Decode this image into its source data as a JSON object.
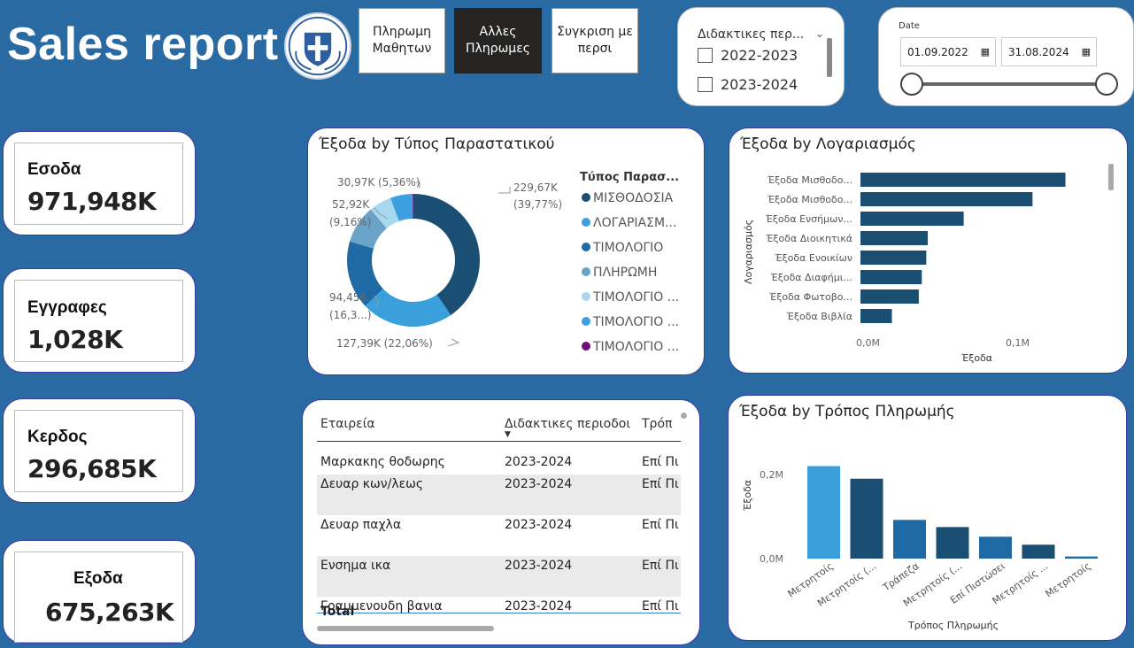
{
  "header": {
    "title": "Sales report",
    "nav_buttons": [
      "Πληρωμη\nΜαθητων",
      "Αλλες\nΠληρωμες",
      "Συγκριση με\nπερσι"
    ]
  },
  "period_slicer": {
    "title": "Διδακτικες περ...",
    "options": [
      "2022-2023",
      "2023-2024"
    ]
  },
  "date_slicer": {
    "label": "Date",
    "start": "01.09.2022",
    "end": "31.08.2024"
  },
  "kpis": [
    {
      "label": "Εσοδα",
      "value": "971,948K"
    },
    {
      "label": "Εγγραφες",
      "value": "1,028K"
    },
    {
      "label": "Κερδος",
      "value": "296,685K"
    },
    {
      "label": "Εξοδα",
      "value": "675,263K"
    }
  ],
  "colors": {
    "background": "#2a6aa3",
    "dark_blue": "#1a4e72",
    "light_blue": "#3aa0db",
    "mid_blue": "#1f6aa5",
    "steel_blue": "#6aa2c8",
    "pale_blue": "#a8d8f0",
    "sky_blue": "#3b9fe0",
    "purple": "#6b0f7a"
  },
  "donut": {
    "title": "Έξοδα by Τύπος Παραστατικού",
    "legend_title": "Τύπος Παρασ...",
    "slice_labels": [
      "229,67K",
      "(39,77%)",
      "127,39K (22,06%)",
      "94,45K",
      "(16,3...)",
      "52,92K",
      "(9,16%)",
      "30,97K (5,36%)"
    ],
    "legend": [
      "ΜΙΣΘΟΔΟΣΙΑ",
      "ΛΟΓΑΡΙΑΣΜ...",
      "ΤΙΜΟΛΟΓΙΟ",
      "ΠΛΗΡΩΜΗ",
      "ΤΙΜΟΛΟΓΙΟ ...",
      "ΤΙΜΟΛΟΓΙΟ ...",
      "ΤΙΜΟΛΟΓΙΟ ..."
    ]
  },
  "hbar": {
    "title": "Έξοδα by Λογαριασμός",
    "ylabel": "Λογαριασμός",
    "xlabel": "Έξοδα",
    "ticks": [
      "0,0M",
      "0,1M"
    ],
    "categories": [
      "Έξοδα Μισθοδο...",
      "Έξοδα Μισθοδο...",
      "Έξοδα Ενσήμων...",
      "Έξοδα Διοικητικά",
      "Έξοδα Ενοικίων",
      "Έξοδα Διαφήμι...",
      "Έξοδα Φωτοβο...",
      "Έξοδα Βιβλία"
    ]
  },
  "vbar": {
    "title": "Έξοδα by Τρόπος Πληρωμής",
    "ylabel": "Έξοδα",
    "xlabel": "Τρόπος Πληρωμής",
    "ticks": [
      "0,2M",
      "0,0M"
    ],
    "categories": [
      "Μετρητοίς",
      "Μετρητοίς (...",
      "Τράπεζα",
      "Μετρητοίς (...",
      "Επί Πιστώσει",
      "Μετρητοίς ...",
      "Μετρητοίς"
    ]
  },
  "table": {
    "headers": [
      "Εταιρεία",
      "Διδακτικες περιοδοι",
      "Τρόπ"
    ],
    "rows": [
      [
        "Μαρκακης θοδωρης",
        "2023-2024",
        "Επί Πι"
      ],
      [
        "Δευαρ κων/λεως",
        "2023-2024",
        "Επί Πι"
      ],
      [
        "Δευαρ παχλα",
        "2023-2024",
        "Επί Πι"
      ],
      [
        "Ενσημα ικα",
        "2023-2024",
        "Επί Πι"
      ],
      [
        "Γραμμενουδη βανια",
        "2023-2024",
        "Επί Πι"
      ]
    ],
    "total_label": "Total"
  },
  "chart_data": [
    {
      "type": "pie",
      "title": "Έξοδα by Τύπος Παραστατικού",
      "legend_title": "Τύπος Παρασ...",
      "categories": [
        "ΜΙΣΘΟΔΟΣΙΑ",
        "ΛΟΓΑΡΙΑΣΜ...",
        "ΤΙΜΟΛΟΓΙΟ",
        "ΠΛΗΡΩΜΗ",
        "ΤΙΜΟΛΟΓΙΟ ...",
        "ΤΙΜΟΛΟΓΙΟ ...",
        "ΤΙΜΟΛΟΓΙΟ ..."
      ],
      "values": [
        229.67,
        127.39,
        94.45,
        52.92,
        30.97,
        30.97,
        1.0
      ],
      "percent": [
        39.77,
        22.06,
        16.3,
        9.16,
        5.36,
        5.36,
        0.2
      ],
      "colors": [
        "#1a4e72",
        "#3aa0db",
        "#1f6aa5",
        "#6aa2c8",
        "#a8d8f0",
        "#3b9fe0",
        "#6b0f7a"
      ],
      "legend_placement": "right"
    },
    {
      "type": "bar",
      "orientation": "horizontal",
      "title": "Έξοδα by Λογαριασμός",
      "categories": [
        "Έξοδα Μισθοδο...",
        "Έξοδα Μισθοδο...",
        "Έξοδα Ενσήμων...",
        "Έξοδα Διοικητικά",
        "Έξοδα Ενοικίων",
        "Έξοδα Διαφήμι...",
        "Έξοδα Φωτοβο...",
        "Έξοδα Βιβλία"
      ],
      "values": [
        0.137,
        0.115,
        0.069,
        0.045,
        0.044,
        0.041,
        0.039,
        0.021
      ],
      "xlabel": "Έξοδα",
      "ylabel": "Λογαριασμός",
      "xlim": [
        0,
        0.16
      ],
      "color": "#1a4e72"
    },
    {
      "type": "bar",
      "title": "Έξοδα by Τρόπος Πληρωμής",
      "categories": [
        "Μετρητοίς",
        "Μετρητοίς (...",
        "Τράπεζα",
        "Μετρητοίς (...",
        "Επί Πιστώσει",
        "Μετρητοίς ...",
        "Μετρητοίς"
      ],
      "values": [
        0.22,
        0.19,
        0.092,
        0.075,
        0.052,
        0.033,
        0.005
      ],
      "colors": [
        "#3aa0db",
        "#1a4e72",
        "#1f6aa5",
        "#1a4e72",
        "#1f6aa5",
        "#1a4e72",
        "#1f6aa5"
      ],
      "xlabel": "Τρόπος Πληρωμής",
      "ylabel": "Έξοδα",
      "ylim": [
        0,
        0.24
      ]
    }
  ]
}
